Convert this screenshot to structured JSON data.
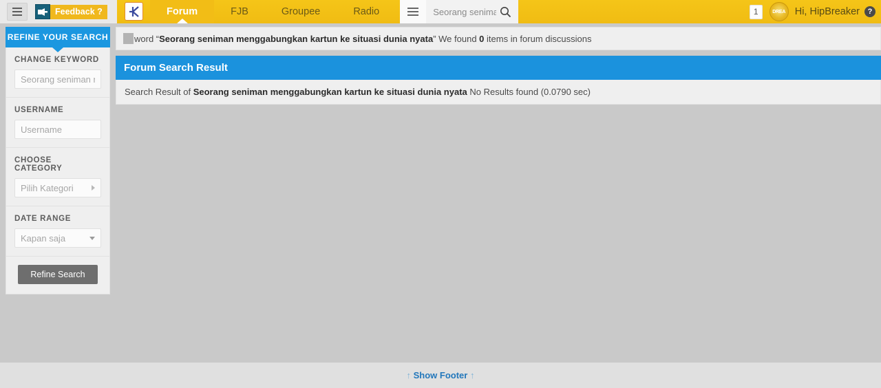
{
  "topnav": {
    "menu_icon": "hamburger-icon",
    "feedback_label": "Feedback ?",
    "feedback_icon": "hand-megaphone-icon",
    "logo_text": "K",
    "tabs": [
      {
        "label": "Forum",
        "active": true
      },
      {
        "label": "FJB",
        "active": false
      },
      {
        "label": "Groupee",
        "active": false
      },
      {
        "label": "Radio",
        "active": false
      }
    ],
    "search_menu_icon": "list-menu-icon",
    "search_value": "Seorang seniman menggabungkan kartun ke situasi dunia nyata",
    "search_placeholder": "Seorang senima",
    "search_icon": "magnifier-icon",
    "notification_count": "1",
    "avatar_text": "DREA",
    "greeting": "Hi, HipBreaker",
    "help_icon": "question-circle-icon",
    "accent_color": "#f0c419",
    "active_tab_color": "#f2bd16"
  },
  "sidebar": {
    "panel_title": "REFINE YOUR SEARCH",
    "panel_color": "#1b97e0",
    "fields": [
      {
        "label": "CHANGE KEYWORD",
        "type": "input",
        "placeholder": "Seorang seniman me",
        "value": ""
      },
      {
        "label": "USERNAME",
        "type": "input",
        "placeholder": "Username",
        "value": ""
      },
      {
        "label": "CHOOSE CATEGORY",
        "type": "select-right",
        "placeholder": "Pilih Kategori",
        "value": "Pilih Kategori"
      },
      {
        "label": "DATE RANGE",
        "type": "select-down",
        "placeholder": "Kapan saja",
        "value": "Kapan saja"
      }
    ],
    "submit_label": "Refine Search"
  },
  "main": {
    "notice": {
      "prefix": "word ",
      "quote_open": "“",
      "keyword": "Seorang seniman menggabungkan kartun ke situasi dunia nyata",
      "quote_close": "”",
      "middle": " We found ",
      "count": "0",
      "suffix": " items in forum discussions"
    },
    "result": {
      "header": "Forum Search Result",
      "header_color": "#1b92dd",
      "lead": "Search Result of ",
      "keyword": "Seorang seniman menggabungkan kartun ke situasi dunia nyata",
      "status": " No Results found (0.0790 sec)"
    }
  },
  "footer": {
    "arrow_left": "↑",
    "label": "Show Footer",
    "arrow_right": "↑",
    "link_color": "#2277bb"
  }
}
